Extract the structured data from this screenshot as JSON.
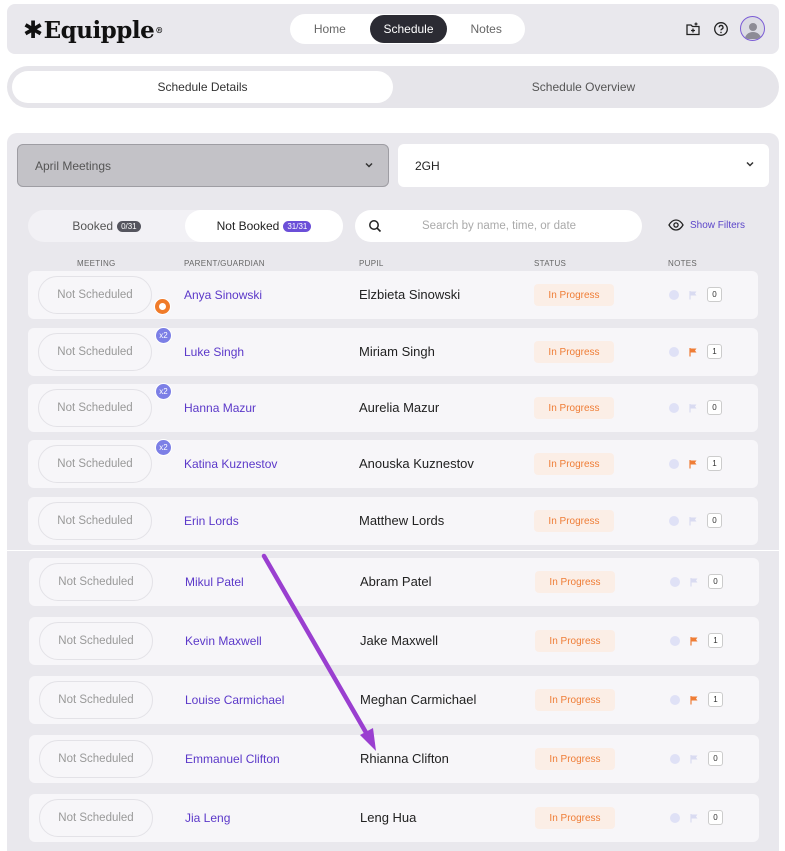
{
  "header": {
    "logo": "Equipple",
    "logo_mark": "®",
    "nav": [
      {
        "label": "Home",
        "active": false
      },
      {
        "label": "Schedule",
        "active": true
      },
      {
        "label": "Notes",
        "active": false
      }
    ],
    "icons": [
      "add-folder-icon",
      "help-icon",
      "avatar-icon"
    ]
  },
  "tabs": [
    {
      "label": "Schedule Details",
      "active": true
    },
    {
      "label": "Schedule Overview",
      "active": false
    }
  ],
  "filters": {
    "meeting_select": "April Meetings",
    "group_select": "2GH"
  },
  "booking": {
    "booked_label": "Booked",
    "booked_count": "0/31",
    "not_booked_label": "Not Booked",
    "not_booked_count": "31/31"
  },
  "search": {
    "placeholder": "Search by name, time, or date",
    "value": ""
  },
  "show_filters": "Show Filters",
  "columns": {
    "meeting": "MEETING",
    "parent": "PARENT/GUARDIAN",
    "pupil": "PUPIL",
    "status": "STATUS",
    "notes": "NOTES"
  },
  "colors": {
    "accent": "#5b38c9",
    "status_text": "#ef7d36",
    "status_bg": "#fbeee6",
    "arrow": "#9a3fd0"
  },
  "rows": [
    {
      "meeting": "Not Scheduled",
      "badge": "chat",
      "parent": "Anya Sinowski",
      "pupil": "Elzbieta Sinowski",
      "status": "In Progress",
      "flag": false,
      "count": "0"
    },
    {
      "meeting": "Not Scheduled",
      "badge": "x2",
      "parent": "Luke Singh",
      "pupil": "Miriam Singh",
      "status": "In Progress",
      "flag": true,
      "count": "1"
    },
    {
      "meeting": "Not Scheduled",
      "badge": "x2",
      "parent": "Hanna Mazur",
      "pupil": "Aurelia Mazur",
      "status": "In Progress",
      "flag": false,
      "count": "0"
    },
    {
      "meeting": "Not Scheduled",
      "badge": "x2",
      "parent": "Katina Kuznestov",
      "pupil": "Anouska Kuznestov",
      "status": "In Progress",
      "flag": true,
      "count": "1"
    },
    {
      "meeting": "Not Scheduled",
      "badge": "",
      "parent": "Erin Lords",
      "pupil": "Matthew Lords",
      "status": "In Progress",
      "flag": false,
      "count": "0"
    },
    {
      "meeting": "Not Scheduled",
      "badge": "",
      "parent": "Mikul Patel",
      "pupil": "Abram Patel",
      "status": "In Progress",
      "flag": false,
      "count": "0"
    },
    {
      "meeting": "Not Scheduled",
      "badge": "",
      "parent": "Kevin Maxwell",
      "pupil": "Jake Maxwell",
      "status": "In Progress",
      "flag": true,
      "count": "1"
    },
    {
      "meeting": "Not Scheduled",
      "badge": "",
      "parent": "Louise Carmichael",
      "pupil": "Meghan Carmichael",
      "status": "In Progress",
      "flag": true,
      "count": "1"
    },
    {
      "meeting": "Not Scheduled",
      "badge": "",
      "parent": "Emmanuel Clifton",
      "pupil": "Rhianna Clifton",
      "status": "In Progress",
      "flag": false,
      "count": "0"
    },
    {
      "meeting": "Not Scheduled",
      "badge": "",
      "parent": "Jia Leng",
      "pupil": "Leng Hua",
      "status": "In Progress",
      "flag": false,
      "count": "0"
    }
  ]
}
